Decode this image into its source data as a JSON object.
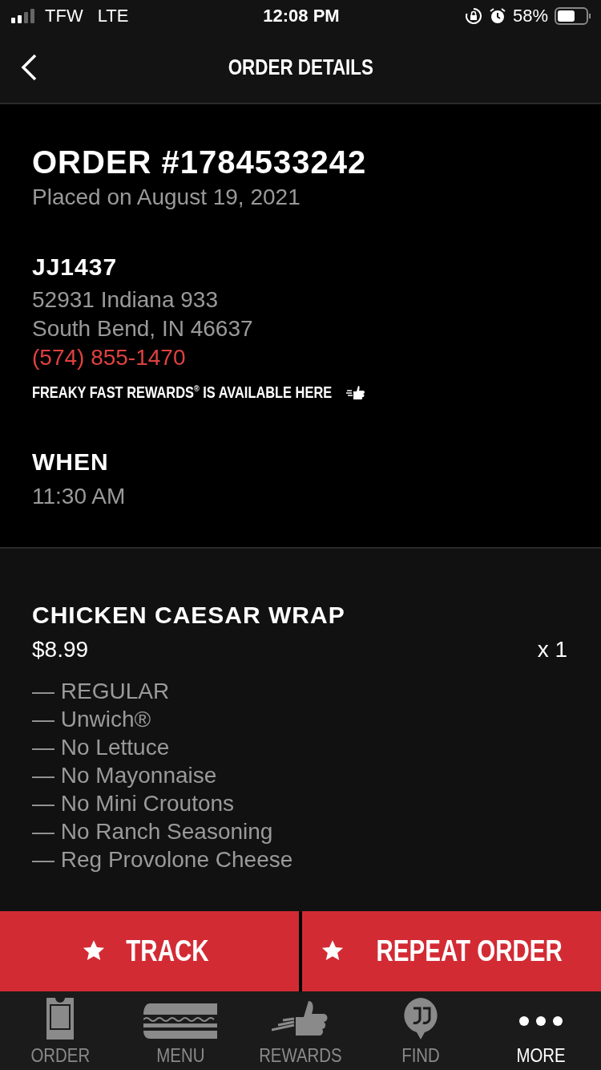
{
  "status_bar": {
    "carrier": "TFW",
    "network": "LTE",
    "time": "12:08 PM",
    "battery": "58%"
  },
  "header": {
    "title": "ORDER DETAILS"
  },
  "order": {
    "number": "ORDER #1784533242",
    "placed": "Placed on August 19, 2021",
    "store": "JJ1437",
    "address": [
      "52931 Indiana 933",
      "South Bend, IN 46637"
    ],
    "phone": "(574) 855-1470",
    "rewards_note": "FREAKY FAST REWARDS$^{®}$ IS AVAILABLE HERE",
    "when_label": "WHEN",
    "when": "11:30 AM"
  },
  "items": [
    {
      "name": "CHICKEN CAESAR WRAP",
      "price": "$8.99",
      "quantity": "x 1",
      "options": [
        "— REGULAR",
        "— Unwich®",
        "— No Lettuce",
        "— No Mayonnaise",
        "— No Mini Croutons",
        "— No Ranch Seasoning",
        "— Reg Provolone Cheese"
      ]
    }
  ],
  "actions": [
    {
      "label": "TRACK"
    },
    {
      "label": "REPEAT ORDER"
    }
  ],
  "tabs": [
    {
      "label": "ORDER",
      "kind": "order",
      "selected": false
    },
    {
      "label": "MENU",
      "kind": "menu",
      "selected": false
    },
    {
      "label": "REWARDS",
      "kind": "rewards",
      "selected": false
    },
    {
      "label": "FIND",
      "kind": "find",
      "selected": false
    },
    {
      "label": "MORE",
      "kind": "more",
      "selected": true
    }
  ]
}
